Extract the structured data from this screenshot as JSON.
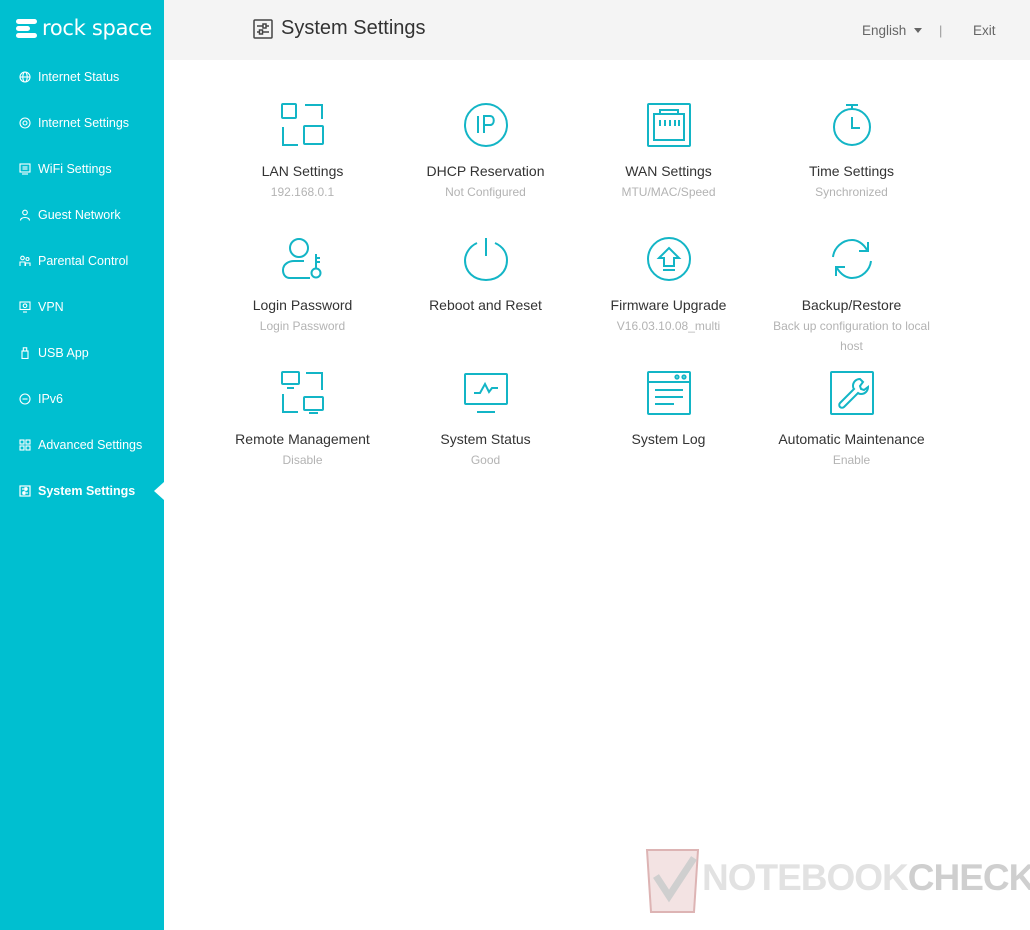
{
  "brand": {
    "name": "rock space"
  },
  "header": {
    "title": "System Settings",
    "language": "English",
    "separator": "|",
    "exit_label": "Exit"
  },
  "sidebar": {
    "items": [
      {
        "label": "Internet Status",
        "icon": "globe-icon"
      },
      {
        "label": "Internet Settings",
        "icon": "network-icon"
      },
      {
        "label": "WiFi Settings",
        "icon": "wifi-icon"
      },
      {
        "label": "Guest Network",
        "icon": "guest-icon"
      },
      {
        "label": "Parental Control",
        "icon": "family-icon"
      },
      {
        "label": "VPN",
        "icon": "vpn-icon"
      },
      {
        "label": "USB App",
        "icon": "usb-icon"
      },
      {
        "label": "IPv6",
        "icon": "ipv6-icon"
      },
      {
        "label": "Advanced Settings",
        "icon": "grid-icon"
      },
      {
        "label": "System Settings",
        "icon": "sliders-icon",
        "active": true
      }
    ]
  },
  "tiles": [
    {
      "name": "LAN Settings",
      "status": "192.168.0.1",
      "icon": "lan-icon"
    },
    {
      "name": "DHCP Reservation",
      "status": "Not Configured",
      "icon": "ip-icon"
    },
    {
      "name": "WAN Settings",
      "status": "MTU/MAC/Speed",
      "icon": "ethernet-port-icon"
    },
    {
      "name": "Time Settings",
      "status": "Synchronized",
      "icon": "stopwatch-icon"
    },
    {
      "name": "Login Password",
      "status": "Login Password",
      "icon": "user-key-icon"
    },
    {
      "name": "Reboot and Reset",
      "status": "",
      "icon": "power-icon"
    },
    {
      "name": "Firmware Upgrade",
      "status": "V16.03.10.08_multi",
      "icon": "upgrade-icon"
    },
    {
      "name": "Backup/Restore",
      "status": "Back up configuration to local host",
      "icon": "sync-icon"
    },
    {
      "name": "Remote Management",
      "status": "Disable",
      "icon": "remote-icon"
    },
    {
      "name": "System Status",
      "status": "Good",
      "icon": "monitor-icon"
    },
    {
      "name": "System Log",
      "status": "",
      "icon": "log-icon"
    },
    {
      "name": "Automatic Maintenance",
      "status": "Enable",
      "icon": "wrench-icon"
    }
  ],
  "watermark": {
    "text_a": "NOTEBOOK",
    "text_b": "CHECK"
  },
  "colors": {
    "accent": "#00bfd0",
    "sidebar_bg": "#00bfd0",
    "header_bg": "#f4f4f4",
    "icon": "#13b5c6",
    "status_text": "#b3b3b3"
  }
}
